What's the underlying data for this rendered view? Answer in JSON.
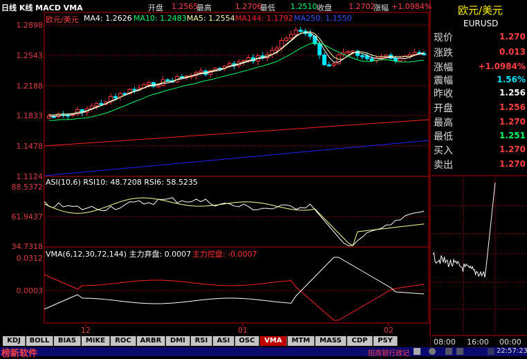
{
  "header": {
    "title": "日线 K线 MACD VMA",
    "open_label": "开盘",
    "open_value": "1.2565",
    "high_label": "最高",
    "high_value": "1.2706",
    "low_label": "最低",
    "low_value": "1.2510",
    "close_label": "收盘",
    "close_value": "1.2702",
    "change_label": "涨幅",
    "change_value": "+1.0984%"
  },
  "main_panel": {
    "symbol": "欧元/美元",
    "ma4": "MA4: 1.2626",
    "ma10": "MA10: 1.2483",
    "ma5": "MA5: 1.2554",
    "ma144": "MA144: 1.1792",
    "ma250": "MA250: 1.1550",
    "y_ticks": [
      "1.2898",
      "1.2543",
      "1.2188",
      "1.1833",
      "1.1478",
      "1.1124"
    ]
  },
  "asi_panel": {
    "label": "ASI(10,6)  RSI10: 48.7208  RSI6: 58.5235",
    "y_ticks": [
      "88.5372",
      "61.9437",
      "34.7318"
    ]
  },
  "vma_panel": {
    "label": "VMA(6,12,30,72,144)  主力弃盘: 0.0007",
    "label2": "主力控盘: -0.0007",
    "y_ticks": [
      "0.0312",
      "0.0003"
    ]
  },
  "x_axis": [
    "12",
    "01",
    "02"
  ],
  "tabs": [
    "KDJ",
    "BOLL",
    "BIAS",
    "MIKE",
    "ROC",
    "ARBR",
    "DMI",
    "RSI",
    "ASI",
    "OSC",
    "VMA",
    "MTM",
    "MASS",
    "CDP",
    "PSY"
  ],
  "active_tab": "VMA",
  "quote": {
    "name": "欧元/美元",
    "code": "EURUSD",
    "rows": [
      {
        "label": "现价",
        "value": "1.270"
      },
      {
        "label": "涨跌",
        "value": "0.013"
      },
      {
        "label": "涨幅",
        "value": "+1.0984%"
      },
      {
        "label": "震幅",
        "value": "1.56%"
      },
      {
        "label": "昨收",
        "value": "1.256"
      },
      {
        "label": "开盘",
        "value": "1.256"
      },
      {
        "label": "最高",
        "value": "1.270"
      },
      {
        "label": "最低",
        "value": "1.251"
      },
      {
        "label": "买入",
        "value": "1.270"
      },
      {
        "label": "卖出",
        "value": "1.270"
      }
    ]
  },
  "intraday_axis": [
    "08:00",
    "16:00",
    "00:00"
  ],
  "status": {
    "left": "榜新软件",
    "news": "招商银行政记",
    "time": "22:57:23"
  },
  "colors": {
    "up": "#ff3b3b",
    "down": "#00e5ff",
    "grid": "#b00000",
    "ma4": "#ffffff",
    "ma10": "#00ff66",
    "ma5": "#ffffaa",
    "ma144": "#ff2020",
    "ma250": "#2020ff"
  }
}
